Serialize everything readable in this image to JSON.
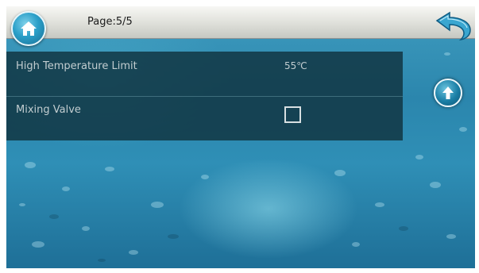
{
  "header": {
    "page_indicator": "Page:5/5",
    "home_icon": "home-icon",
    "back_icon": "back-arrow-icon"
  },
  "settings": {
    "rows": [
      {
        "label": "High Temperature Limit",
        "value": "55℃"
      },
      {
        "label": "Mixing Valve",
        "checked": false
      }
    ]
  },
  "navigation": {
    "up_icon": "up-arrow-icon"
  },
  "colors": {
    "accent": "#2b9fc8",
    "panel": "#123744"
  }
}
